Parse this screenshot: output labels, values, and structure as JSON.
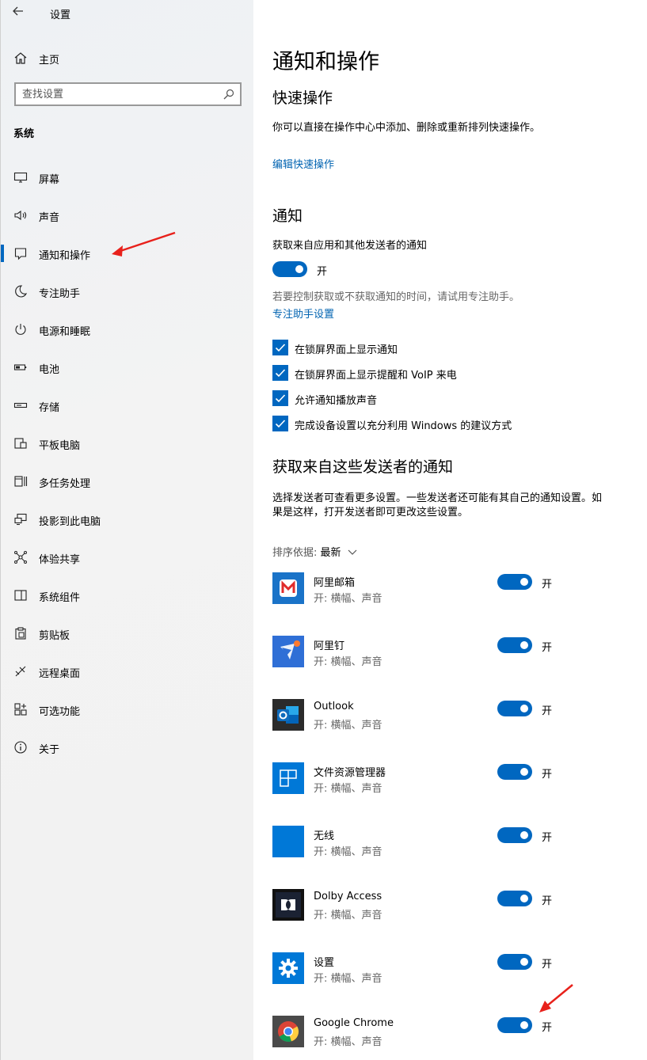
{
  "window": {
    "title": "设置"
  },
  "sidebar": {
    "home": "主页",
    "search_placeholder": "查找设置",
    "section": "系统",
    "items": [
      {
        "label": "屏幕",
        "icon": "monitor-icon"
      },
      {
        "label": "声音",
        "icon": "speaker-icon"
      },
      {
        "label": "通知和操作",
        "icon": "notification-icon",
        "active": true
      },
      {
        "label": "专注助手",
        "icon": "moon-icon"
      },
      {
        "label": "电源和睡眠",
        "icon": "power-icon"
      },
      {
        "label": "电池",
        "icon": "battery-icon"
      },
      {
        "label": "存储",
        "icon": "storage-icon"
      },
      {
        "label": "平板电脑",
        "icon": "tablet-icon"
      },
      {
        "label": "多任务处理",
        "icon": "multitask-icon"
      },
      {
        "label": "投影到此电脑",
        "icon": "project-icon"
      },
      {
        "label": "体验共享",
        "icon": "share-icon"
      },
      {
        "label": "系统组件",
        "icon": "components-icon"
      },
      {
        "label": "剪贴板",
        "icon": "clipboard-icon"
      },
      {
        "label": "远程桌面",
        "icon": "remote-icon"
      },
      {
        "label": "可选功能",
        "icon": "features-icon"
      },
      {
        "label": "关于",
        "icon": "info-icon"
      }
    ]
  },
  "main": {
    "title": "通知和操作",
    "quick": {
      "heading": "快速操作",
      "desc": "你可以直接在操作中心中添加、删除或重新排列快速操作。",
      "link": "编辑快速操作"
    },
    "notify": {
      "heading": "通知",
      "get_label": "获取来自应用和其他发送者的通知",
      "toggle_state": "开",
      "hint": "若要控制获取或不获取通知的时间，请试用专注助手。",
      "hint_link": "专注助手设置",
      "checks": [
        "在锁屏界面上显示通知",
        "在锁屏界面上显示提醒和 VoIP 来电",
        "允许通知播放声音",
        "完成设备设置以充分利用 Windows 的建议方式"
      ]
    },
    "senders": {
      "heading": "获取来自这些发送者的通知",
      "desc_line1": "选择发送者可查看更多设置。一些发送者还可能有其自己的通知设置。如",
      "desc_line2": "果是这样，打开发送者即可更改这些设置。",
      "sort_key": "排序依据:",
      "sort_value": "最新",
      "apps": [
        {
          "name": "阿里邮箱",
          "sub": "开: 横幅、声音",
          "state": "开",
          "color": "#1a73c8"
        },
        {
          "name": "阿里钉",
          "sub": "开: 横幅、声音",
          "state": "开",
          "color": "#2f6fd6"
        },
        {
          "name": "Outlook",
          "sub": "开: 横幅、声音",
          "state": "开",
          "color": "#2b2b2b"
        },
        {
          "name": "文件资源管理器",
          "sub": "开: 横幅、声音",
          "state": "开",
          "color": "#0078d7"
        },
        {
          "name": "无线",
          "sub": "开: 横幅、声音",
          "state": "开",
          "color": "#0078d7"
        },
        {
          "name": "Dolby Access",
          "sub": "开: 横幅、声音",
          "state": "开",
          "color": "#111111"
        },
        {
          "name": "设置",
          "sub": "开: 横幅、声音",
          "state": "开",
          "color": "#0078d7"
        },
        {
          "name": "Google Chrome",
          "sub": "开: 横幅、声音",
          "state": "开",
          "color": "#4a4a4a"
        }
      ]
    }
  }
}
